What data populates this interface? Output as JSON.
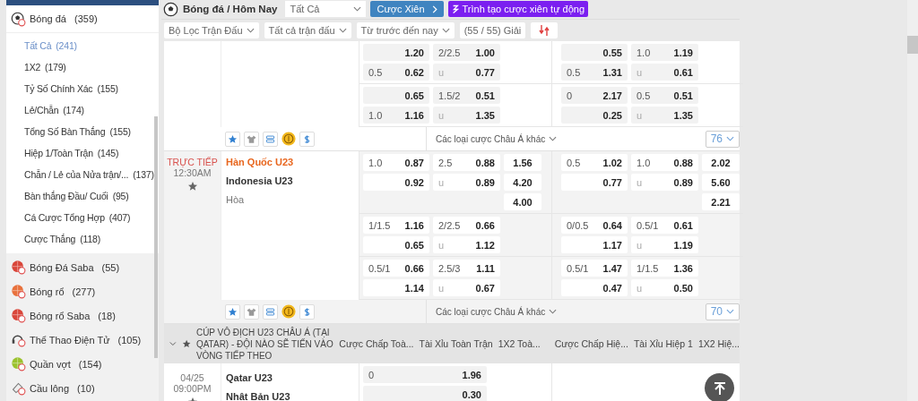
{
  "sidebar": {
    "sport": {
      "name": "Bóng đá",
      "count": "(359)"
    },
    "bet_types": [
      {
        "label": "Tất Cả",
        "count": "(241)",
        "selected": true
      },
      {
        "label": "1X2",
        "count": "(179)",
        "selected": false
      },
      {
        "label": "Tỷ Số Chính Xác",
        "count": "(155)",
        "selected": false
      },
      {
        "label": "Lẻ/Chẵn",
        "count": "(174)",
        "selected": false
      },
      {
        "label": "Tổng Số Bàn Thắng",
        "count": "(155)",
        "selected": false
      },
      {
        "label": "Hiệp 1/Toàn Trận",
        "count": "(145)",
        "selected": false
      },
      {
        "label": "Chẵn / Lẻ của Nửa trận/...",
        "count": "(137)",
        "selected": false
      },
      {
        "label": "Bàn thắng Đầu/ Cuối",
        "count": "(95)",
        "selected": false
      },
      {
        "label": "Cá Cược Tổng Hợp",
        "count": "(407)",
        "selected": false
      },
      {
        "label": "Cược Thắng",
        "count": "(118)",
        "selected": false
      }
    ],
    "sports": [
      {
        "kind": "soccer-saba",
        "name": "Bóng Đá Saba",
        "count": "(55)"
      },
      {
        "kind": "basketball",
        "name": "Bóng rổ",
        "count": "(277)"
      },
      {
        "kind": "basketball-saba",
        "name": "Bóng rổ Saba",
        "count": "(18)"
      },
      {
        "kind": "esports",
        "name": "Thể Thao Điện Tử",
        "count": "(105)"
      },
      {
        "kind": "tennis",
        "name": "Quần vợt",
        "count": "(154)"
      },
      {
        "kind": "badminton",
        "name": "Cầu lông",
        "count": "(10)"
      }
    ]
  },
  "header": {
    "breadcrumb": "Bóng đá / Hôm Nay",
    "market_select": "Tất Cả",
    "parlay_button": "Cược Xiên",
    "auto_parlay_button": "Trình tạo cược xiên tự động"
  },
  "filters": [
    "Bộ Lọc Trận Đấu",
    "Tất cả trận đấu",
    "Từ trước đến nay"
  ],
  "league_count": "(55 / 55) Giải",
  "matches": [
    {
      "odds_sets": [
        {
          "ft_handicap": [
            {
              "price": "1.20"
            },
            {
              "line": "0.5",
              "price": "0.62"
            }
          ],
          "ft_over_under": [
            {
              "line": "2/2.5",
              "price": "1.00"
            },
            {
              "line": "u",
              "price": "0.77"
            }
          ],
          "h1_handicap": [
            {
              "price": "0.55"
            },
            {
              "line": "0.5",
              "price": "1.31"
            }
          ],
          "h1_over_under": [
            {
              "line": "1.0",
              "price": "1.19"
            },
            {
              "line": "u",
              "price": "0.61"
            }
          ]
        },
        {
          "ft_handicap": [
            {
              "price": "0.65"
            },
            {
              "line": "1.0",
              "price": "1.16"
            }
          ],
          "ft_over_under": [
            {
              "line": "1.5/2",
              "price": "0.51"
            },
            {
              "line": "u",
              "price": "1.35"
            }
          ],
          "h1_handicap": [
            {
              "line": "0",
              "price": "2.17"
            },
            {
              "price": "0.25"
            }
          ],
          "h1_over_under": [
            {
              "line": "0.5",
              "price": "0.51"
            },
            {
              "line": "u",
              "price": "1.35"
            }
          ]
        }
      ],
      "more_bets": "Các loại cược Châu Á khác",
      "market_count": "76"
    },
    {
      "time_lines": [
        "TRỰC TIẾP",
        "12:30AM"
      ],
      "live": true,
      "teams": [
        {
          "name": "Hàn Quốc U23",
          "favorite": true
        },
        {
          "name": "Indonesia U23",
          "favorite": false
        }
      ],
      "draw": "Hòa",
      "odds_sets": [
        {
          "ft_handicap": [
            {
              "line": "1.0",
              "price": "0.87"
            },
            {
              "price": "0.92"
            }
          ],
          "ft_over_under": [
            {
              "line": "2.5",
              "price": "0.88"
            },
            {
              "line": "u",
              "price": "0.89"
            }
          ],
          "ft_1x2": [
            "1.56",
            "4.20",
            "4.00"
          ],
          "h1_handicap": [
            {
              "line": "0.5",
              "price": "1.02"
            },
            {
              "price": "0.77"
            }
          ],
          "h1_over_under": [
            {
              "line": "1.0",
              "price": "0.88"
            },
            {
              "line": "u",
              "price": "0.89"
            }
          ],
          "h1_1x2": [
            "2.02",
            "5.60",
            "2.21"
          ]
        },
        {
          "ft_handicap": [
            {
              "line": "1/1.5",
              "price": "1.16"
            },
            {
              "price": "0.65"
            }
          ],
          "ft_over_under": [
            {
              "line": "2/2.5",
              "price": "0.66"
            },
            {
              "line": "u",
              "price": "1.12"
            }
          ],
          "h1_handicap": [
            {
              "line": "0/0.5",
              "price": "0.64"
            },
            {
              "price": "1.17"
            }
          ],
          "h1_over_under": [
            {
              "line": "0.5/1",
              "price": "0.61"
            },
            {
              "line": "u",
              "price": "1.19"
            }
          ]
        },
        {
          "ft_handicap": [
            {
              "line": "0.5/1",
              "price": "0.66"
            },
            {
              "price": "1.14"
            }
          ],
          "ft_over_under": [
            {
              "line": "2.5/3",
              "price": "1.11"
            },
            {
              "line": "u",
              "price": "0.67"
            }
          ],
          "h1_handicap": [
            {
              "line": "0.5/1",
              "price": "1.47"
            },
            {
              "price": "0.47"
            }
          ],
          "h1_over_under": [
            {
              "line": "1/1.5",
              "price": "1.36"
            },
            {
              "line": "u",
              "price": "0.50"
            }
          ]
        }
      ],
      "more_bets": "Các loại cược Châu Á khác",
      "market_count": "70"
    }
  ],
  "league": {
    "name": "CÚP VÔ ĐỊCH U23 CHÂU Á (TẠI QATAR) - ĐỘI NÀO SẼ TIẾN VÀO VÒNG TIẾP THEO",
    "columns": [
      "Cược Chấp Toà...",
      "Tài Xỉu Toàn Trận",
      "1X2 Toà...",
      "Cược Chấp Hiệ...",
      "Tài Xỉu Hiệp 1",
      "1X2 Hiệ..."
    ],
    "match": {
      "time_lines": [
        "04/25",
        "09:00PM"
      ],
      "teams": [
        "Qatar U23",
        "Nhật Bản U23"
      ],
      "ft_handicap": [
        {
          "line": "0",
          "price": "1.96"
        },
        {
          "price": "0.30"
        }
      ]
    }
  }
}
